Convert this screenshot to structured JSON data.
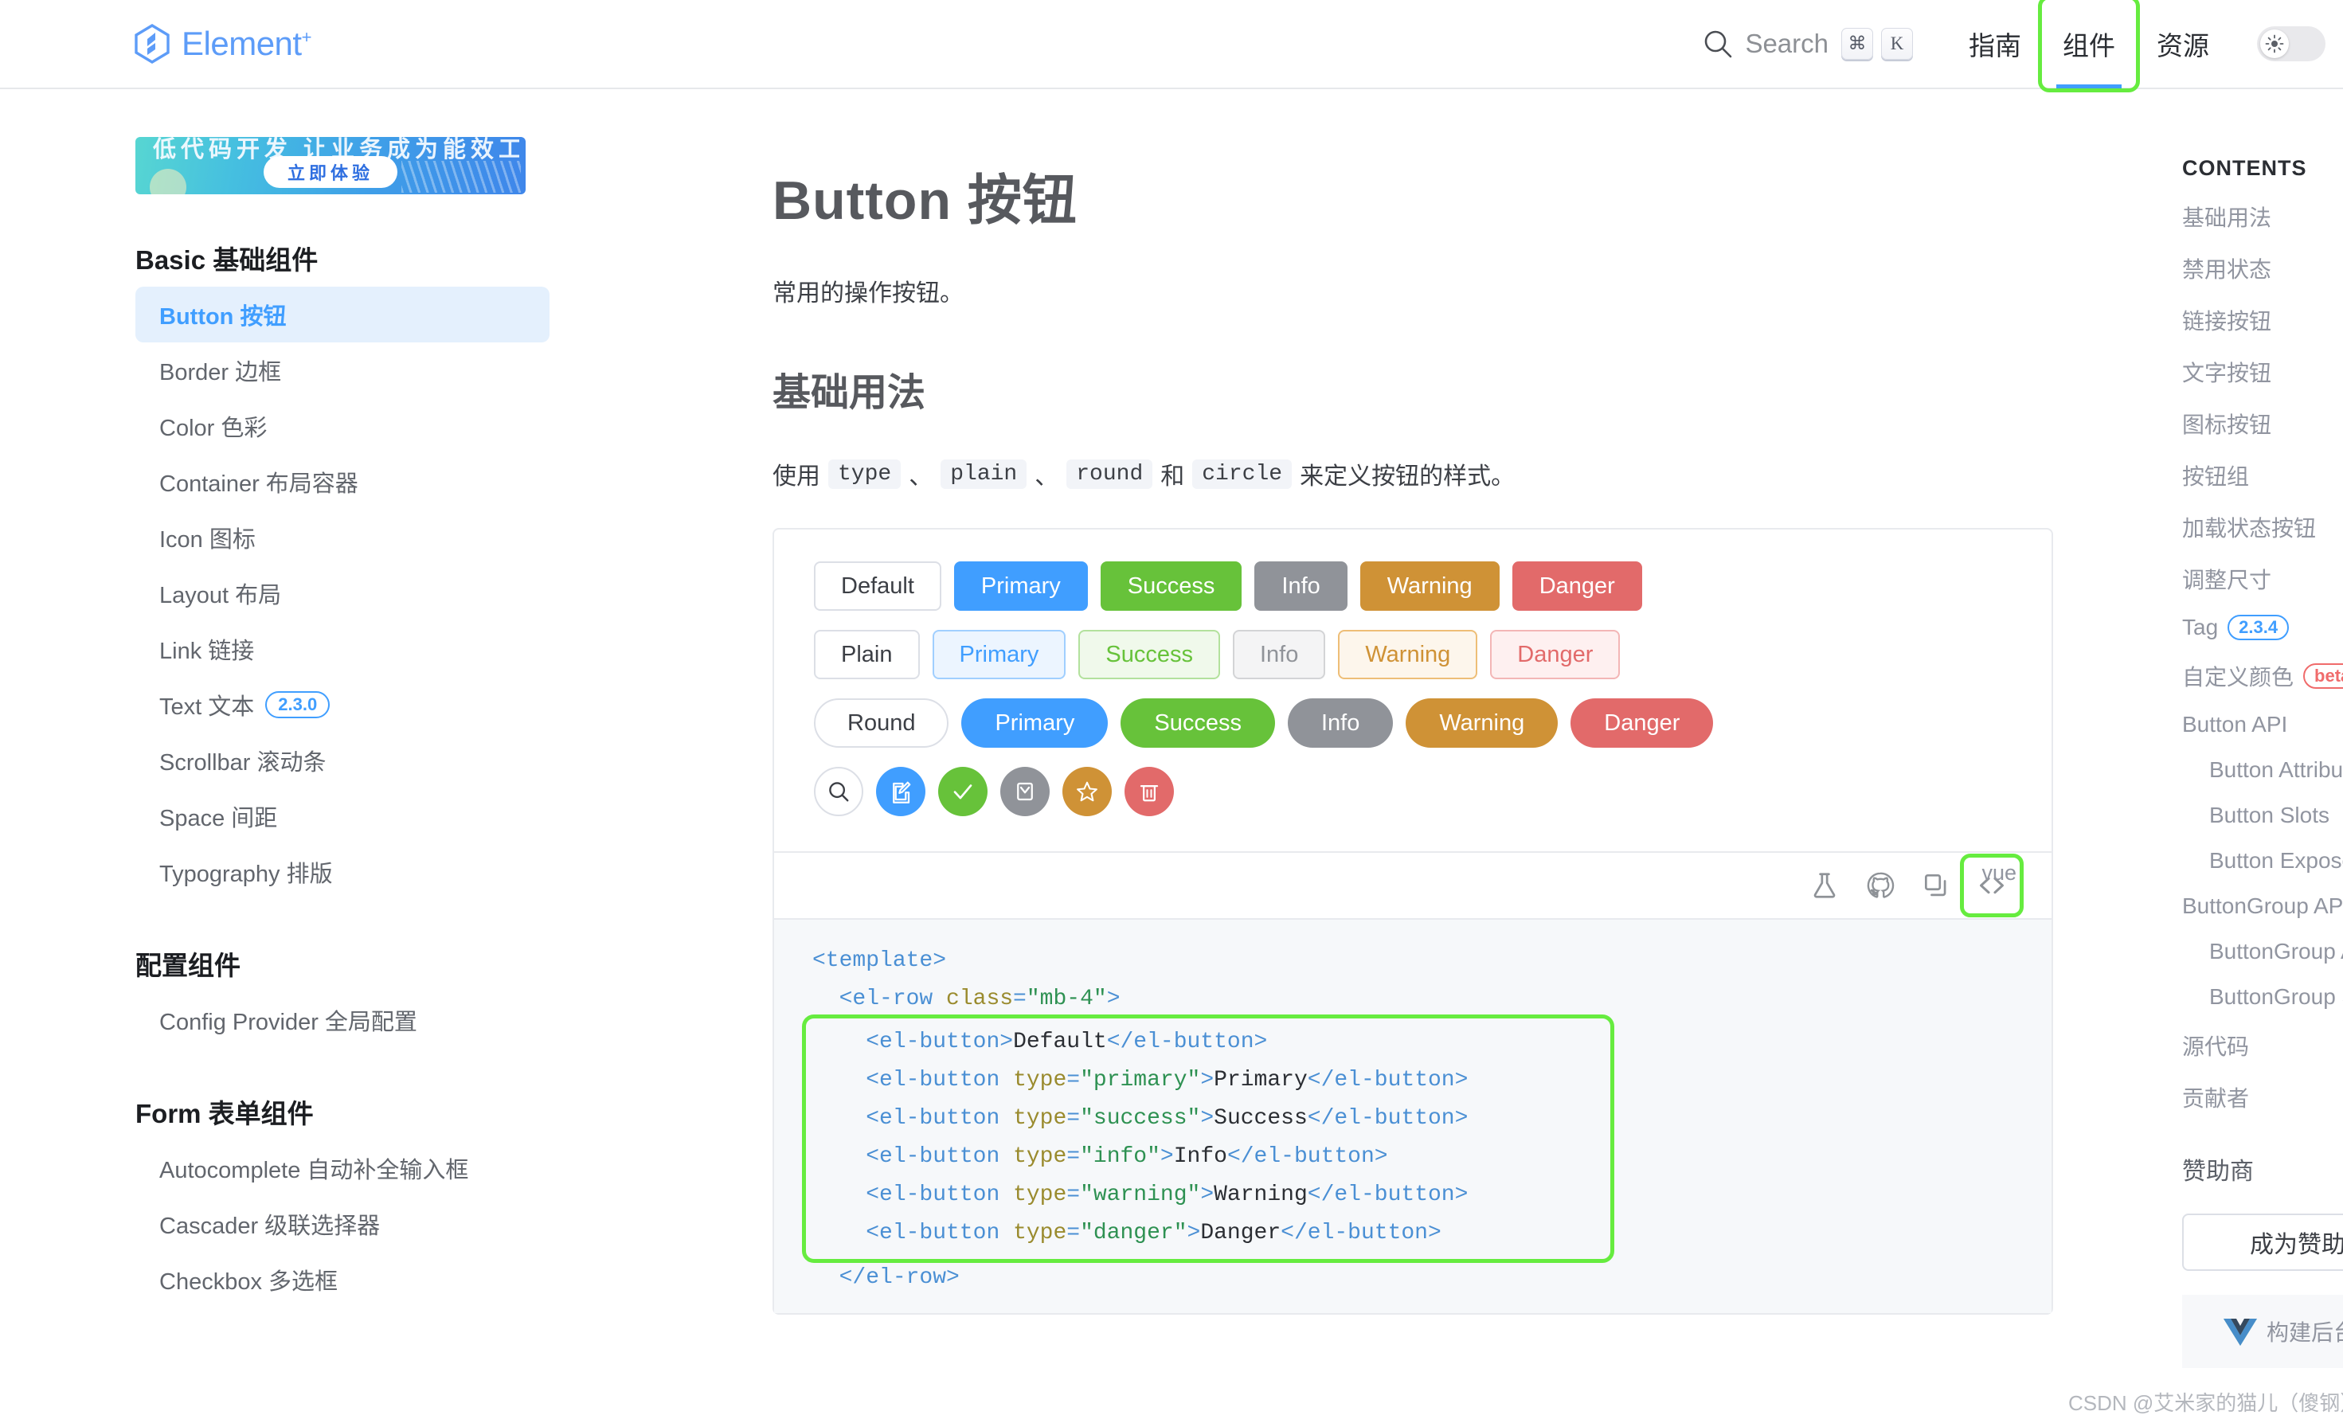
{
  "header": {
    "brand": "Element",
    "brand_sup": "+",
    "search": {
      "label": "Search",
      "keys": [
        "⌘",
        "K"
      ]
    },
    "nav": [
      {
        "label": "指南",
        "active": false,
        "highlighted": false
      },
      {
        "label": "组件",
        "active": true,
        "highlighted": true
      },
      {
        "label": "资源",
        "active": false,
        "highlighted": false
      }
    ],
    "theme_toggle_icon": "sun-icon"
  },
  "sidebar": {
    "ad": {
      "top_text": "低代码开发 让业务成为能效工具",
      "cta": "立即体验"
    },
    "groups": [
      {
        "title": "Basic 基础组件",
        "items": [
          {
            "label": "Button 按钮",
            "active": true,
            "badge": ""
          },
          {
            "label": "Border 边框",
            "active": false,
            "badge": ""
          },
          {
            "label": "Color 色彩",
            "active": false,
            "badge": ""
          },
          {
            "label": "Container 布局容器",
            "active": false,
            "badge": ""
          },
          {
            "label": "Icon 图标",
            "active": false,
            "badge": ""
          },
          {
            "label": "Layout 布局",
            "active": false,
            "badge": ""
          },
          {
            "label": "Link 链接",
            "active": false,
            "badge": ""
          },
          {
            "label": "Text 文本",
            "active": false,
            "badge": "2.3.0"
          },
          {
            "label": "Scrollbar 滚动条",
            "active": false,
            "badge": ""
          },
          {
            "label": "Space 间距",
            "active": false,
            "badge": ""
          },
          {
            "label": "Typography 排版",
            "active": false,
            "badge": ""
          }
        ]
      },
      {
        "title": "配置组件",
        "items": [
          {
            "label": "Config Provider 全局配置",
            "active": false,
            "badge": ""
          }
        ]
      },
      {
        "title": "Form 表单组件",
        "items": [
          {
            "label": "Autocomplete 自动补全输入框",
            "active": false,
            "badge": ""
          },
          {
            "label": "Cascader 级联选择器",
            "active": false,
            "badge": ""
          },
          {
            "label": "Checkbox 多选框",
            "active": false,
            "badge": ""
          }
        ]
      }
    ]
  },
  "main": {
    "title": "Button 按钮",
    "description": "常用的操作按钮。",
    "section_title": "基础用法",
    "usage": {
      "prefix": "使用",
      "chips": [
        "type",
        "plain",
        "round",
        "circle"
      ],
      "sep1": "、",
      "sep2": "、",
      "sep3": "和",
      "suffix": "来定义按钮的样式。"
    },
    "demo": {
      "rows": [
        {
          "kind": "solid",
          "buttons": [
            "Default",
            "Primary",
            "Success",
            "Info",
            "Warning",
            "Danger"
          ]
        },
        {
          "kind": "plain",
          "buttons": [
            "Plain",
            "Primary",
            "Success",
            "Info",
            "Warning",
            "Danger"
          ]
        },
        {
          "kind": "round",
          "buttons": [
            "Round",
            "Primary",
            "Success",
            "Info",
            "Warning",
            "Danger"
          ]
        },
        {
          "kind": "circle",
          "icons": [
            "search-icon",
            "edit-icon",
            "check-icon",
            "message-icon",
            "star-icon",
            "delete-icon"
          ]
        }
      ],
      "toolbar_icons": [
        "flask-icon",
        "github-icon",
        "copy-icon",
        "code-icon"
      ],
      "lang_label": "vue"
    },
    "code": {
      "lines": [
        {
          "highlighted": false,
          "tokens": [
            {
              "t": "tag",
              "v": "<template>"
            }
          ]
        },
        {
          "highlighted": false,
          "tokens": [
            {
              "t": "plain",
              "v": "  "
            },
            {
              "t": "tag",
              "v": "<el-row "
            },
            {
              "t": "attr",
              "v": "class"
            },
            {
              "t": "tag",
              "v": "="
            },
            {
              "t": "str",
              "v": "\"mb-4\""
            },
            {
              "t": "tag",
              "v": ">"
            }
          ]
        },
        {
          "highlighted": true,
          "tokens": [
            {
              "t": "plain",
              "v": "    "
            },
            {
              "t": "tag",
              "v": "<el-button>"
            },
            {
              "t": "text",
              "v": "Default"
            },
            {
              "t": "tag",
              "v": "</el-button>"
            }
          ]
        },
        {
          "highlighted": true,
          "tokens": [
            {
              "t": "plain",
              "v": "    "
            },
            {
              "t": "tag",
              "v": "<el-button "
            },
            {
              "t": "attr",
              "v": "type"
            },
            {
              "t": "tag",
              "v": "="
            },
            {
              "t": "str",
              "v": "\"primary\""
            },
            {
              "t": "tag",
              "v": ">"
            },
            {
              "t": "text",
              "v": "Primary"
            },
            {
              "t": "tag",
              "v": "</el-button>"
            }
          ]
        },
        {
          "highlighted": true,
          "tokens": [
            {
              "t": "plain",
              "v": "    "
            },
            {
              "t": "tag",
              "v": "<el-button "
            },
            {
              "t": "attr",
              "v": "type"
            },
            {
              "t": "tag",
              "v": "="
            },
            {
              "t": "str",
              "v": "\"success\""
            },
            {
              "t": "tag",
              "v": ">"
            },
            {
              "t": "text",
              "v": "Success"
            },
            {
              "t": "tag",
              "v": "</el-button>"
            }
          ]
        },
        {
          "highlighted": true,
          "tokens": [
            {
              "t": "plain",
              "v": "    "
            },
            {
              "t": "tag",
              "v": "<el-button "
            },
            {
              "t": "attr",
              "v": "type"
            },
            {
              "t": "tag",
              "v": "="
            },
            {
              "t": "str",
              "v": "\"info\""
            },
            {
              "t": "tag",
              "v": ">"
            },
            {
              "t": "text",
              "v": "Info"
            },
            {
              "t": "tag",
              "v": "</el-button>"
            }
          ]
        },
        {
          "highlighted": true,
          "tokens": [
            {
              "t": "plain",
              "v": "    "
            },
            {
              "t": "tag",
              "v": "<el-button "
            },
            {
              "t": "attr",
              "v": "type"
            },
            {
              "t": "tag",
              "v": "="
            },
            {
              "t": "str",
              "v": "\"warning\""
            },
            {
              "t": "tag",
              "v": ">"
            },
            {
              "t": "text",
              "v": "Warning"
            },
            {
              "t": "tag",
              "v": "</el-button>"
            }
          ]
        },
        {
          "highlighted": true,
          "tokens": [
            {
              "t": "plain",
              "v": "    "
            },
            {
              "t": "tag",
              "v": "<el-button "
            },
            {
              "t": "attr",
              "v": "type"
            },
            {
              "t": "tag",
              "v": "="
            },
            {
              "t": "str",
              "v": "\"danger\""
            },
            {
              "t": "tag",
              "v": ">"
            },
            {
              "t": "text",
              "v": "Danger"
            },
            {
              "t": "tag",
              "v": "</el-button>"
            }
          ]
        },
        {
          "highlighted": false,
          "tokens": [
            {
              "t": "plain",
              "v": "  "
            },
            {
              "t": "tag",
              "v": "</el-row>"
            }
          ]
        }
      ]
    }
  },
  "toc": {
    "title": "CONTENTS",
    "items": [
      {
        "label": "基础用法",
        "indent": false,
        "badge": ""
      },
      {
        "label": "禁用状态",
        "indent": false,
        "badge": ""
      },
      {
        "label": "链接按钮",
        "indent": false,
        "badge": ""
      },
      {
        "label": "文字按钮",
        "indent": false,
        "badge": ""
      },
      {
        "label": "图标按钮",
        "indent": false,
        "badge": ""
      },
      {
        "label": "按钮组",
        "indent": false,
        "badge": ""
      },
      {
        "label": "加载状态按钮",
        "indent": false,
        "badge": ""
      },
      {
        "label": "调整尺寸",
        "indent": false,
        "badge": ""
      },
      {
        "label": "Tag",
        "indent": false,
        "badge": "2.3.4"
      },
      {
        "label": "自定义颜色",
        "indent": false,
        "badge": "beta"
      },
      {
        "label": "Button API",
        "indent": false,
        "badge": ""
      },
      {
        "label": "Button Attributes",
        "indent": true,
        "badge": ""
      },
      {
        "label": "Button Slots",
        "indent": true,
        "badge": ""
      },
      {
        "label": "Button Exposes",
        "indent": true,
        "badge": ""
      },
      {
        "label": "ButtonGroup API",
        "indent": false,
        "badge": ""
      },
      {
        "label": "ButtonGroup Attributes",
        "indent": true,
        "badge": ""
      },
      {
        "label": "ButtonGroup Slots",
        "indent": true,
        "badge": ""
      },
      {
        "label": "源代码",
        "indent": false,
        "badge": ""
      },
      {
        "label": "贡献者",
        "indent": false,
        "badge": ""
      }
    ],
    "sponsor_title": "赞助商",
    "sponsor_button": "成为赞助商",
    "sponsor_card_name": "构建后台"
  },
  "watermark": "CSDN @艾米家的猫儿（傻钢）",
  "colors": {
    "primary": "#409eff",
    "success": "#67c23a",
    "info": "#909399",
    "warning": "#cf9236",
    "danger": "#e26a6a",
    "highlight": "#66ec3f"
  }
}
